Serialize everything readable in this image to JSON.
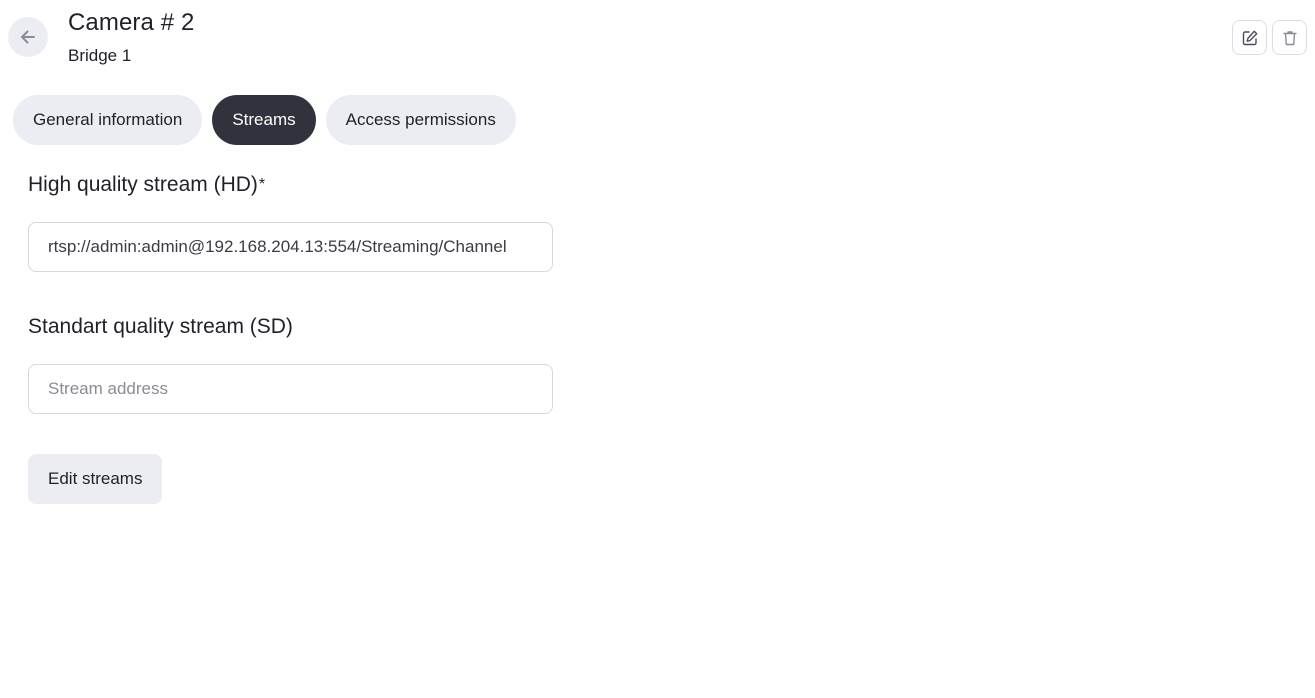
{
  "header": {
    "title": "Camera # 2",
    "subtitle": "Bridge 1",
    "back_icon": "arrow-left-icon",
    "edit_icon": "pencil-square-icon",
    "delete_icon": "trash-icon"
  },
  "tabs": [
    {
      "label": "General information",
      "active": false
    },
    {
      "label": "Streams",
      "active": true
    },
    {
      "label": "Access permissions",
      "active": false
    }
  ],
  "streams": {
    "hd": {
      "label": "High quality stream (HD)",
      "required_mark": "*",
      "value": "rtsp://admin:admin@192.168.204.13:554/Streaming/Channel"
    },
    "sd": {
      "label": "Standart quality stream (SD)",
      "value": "",
      "placeholder": "Stream address"
    },
    "edit_label": "Edit streams"
  },
  "colors": {
    "active_tab_bg": "#30333b",
    "inactive_tab_bg": "#ecedf3",
    "text": "#1f2128"
  }
}
